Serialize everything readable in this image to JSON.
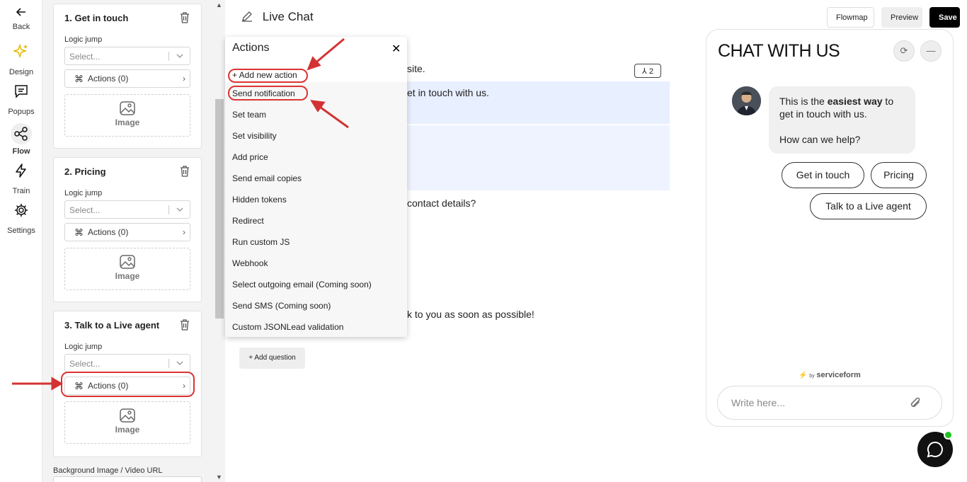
{
  "rail": {
    "back": "Back",
    "items": [
      {
        "label": "Design",
        "icon": "sparkle-icon"
      },
      {
        "label": "Popups",
        "icon": "chat-square-icon"
      },
      {
        "label": "Flow",
        "icon": "share-nodes-icon"
      },
      {
        "label": "Train",
        "icon": "bolt-icon"
      },
      {
        "label": "Settings",
        "icon": "gear-icon"
      }
    ],
    "active": "Flow"
  },
  "questions": [
    {
      "title": "1. Get in touch",
      "logic_label": "Logic jump",
      "select_placeholder": "Select...",
      "actions_label": "Actions (0)",
      "image_label": "Image"
    },
    {
      "title": "2. Pricing",
      "logic_label": "Logic jump",
      "select_placeholder": "Select...",
      "actions_label": "Actions (0)",
      "image_label": "Image"
    },
    {
      "title": "3. Talk to a Live agent",
      "logic_label": "Logic jump",
      "select_placeholder": "Select...",
      "actions_label": "Actions (0)",
      "image_label": "Image"
    }
  ],
  "background_label": "Background Image / Video URL",
  "header": {
    "title": "Live Chat",
    "flowmap": "Flowmap",
    "preview": "Preview",
    "save": "Save"
  },
  "editor": {
    "line1": "site.",
    "badge": "2",
    "line2": "et in touch with us.",
    "line3": "contact details?",
    "line4": "k to you as soon as possible!",
    "add_question": "+ Add question"
  },
  "actions_menu": {
    "title": "Actions",
    "close": "✕",
    "add_new": "+ Add new action",
    "items": [
      "Send notification",
      "Set team",
      "Set visibility",
      "Add price",
      "Send email copies",
      "Hidden tokens",
      "Redirect",
      "Run custom JS",
      "Webhook",
      "Select outgoing email (Coming soon)",
      "Send SMS (Coming soon)",
      "Custom JSONLead validation"
    ]
  },
  "chat": {
    "title": "CHAT WITH US",
    "bubble_pre": "This is the ",
    "bubble_bold": "easiest way",
    "bubble_post": " to get in touch with us.",
    "bubble_line2": "How can we help?",
    "replies": [
      "Get in touch",
      "Pricing",
      "Talk to a Live agent"
    ],
    "powered_by": "by",
    "brand": "serviceform",
    "input_placeholder": "Write here..."
  },
  "colors": {
    "annotation": "#d33333",
    "highlight_band": "#e8efff",
    "online": "#1ec31e"
  }
}
